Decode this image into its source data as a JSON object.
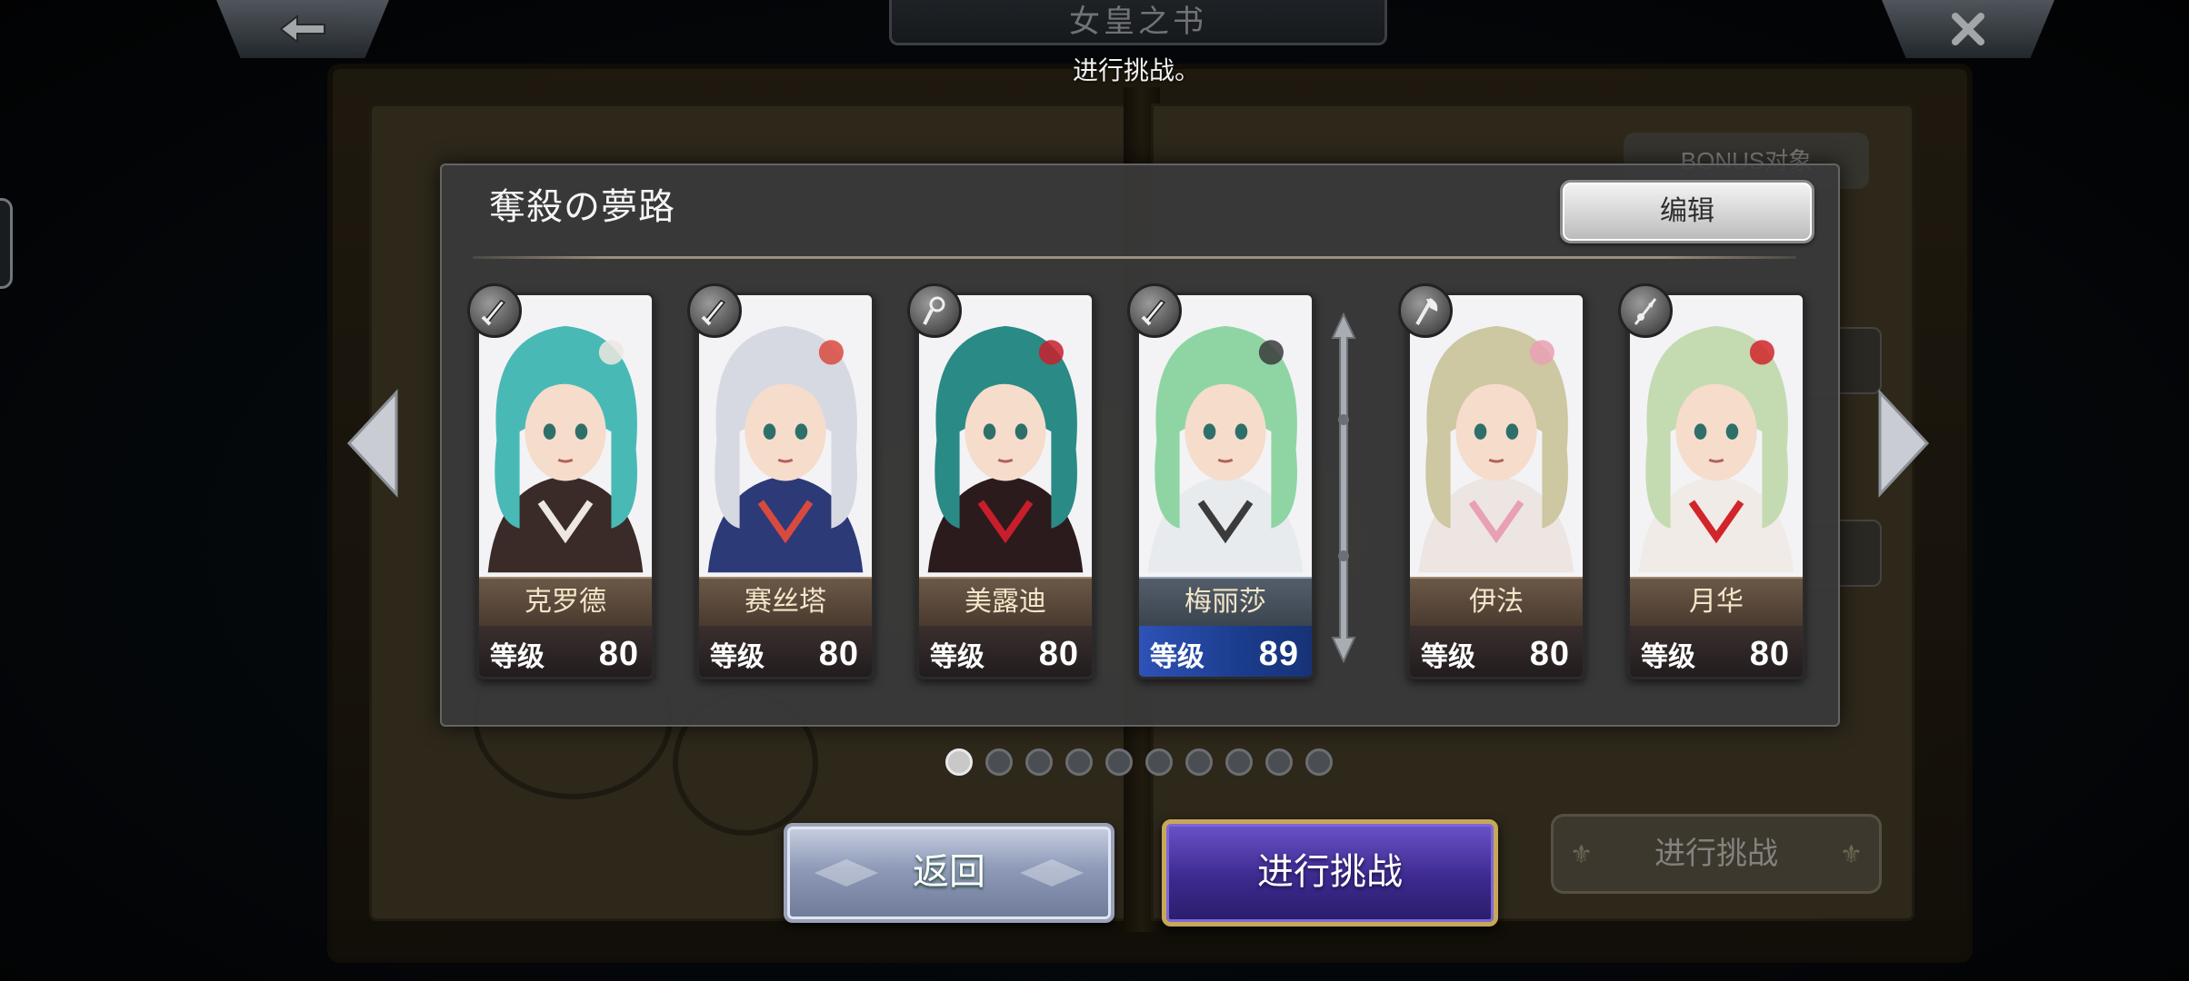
{
  "header": {
    "book_title": "女皇之书",
    "hint_text": "进行挑战。"
  },
  "background": {
    "bonus_label": "BONUS对象",
    "challenge_label": "进行挑战"
  },
  "party": {
    "title": "奪殺の夢路",
    "edit_label": "编辑",
    "level_label": "等级",
    "members": [
      {
        "name": "克罗德",
        "level": "80",
        "class_icon": "sword-icon",
        "hair": "#49b9b6",
        "outfit": "#3a2b28",
        "accent": "#ece8df"
      },
      {
        "name": "赛丝塔",
        "level": "80",
        "class_icon": "sword-icon",
        "hair": "#d7d9e2",
        "outfit": "#2c3a78",
        "accent": "#d94a3e"
      },
      {
        "name": "美露迪",
        "level": "80",
        "class_icon": "staff-icon",
        "hair": "#2a8a86",
        "outfit": "#2b1b1d",
        "accent": "#c81e2c"
      },
      {
        "name": "梅丽莎",
        "level": "89",
        "class_icon": "sword-icon",
        "hair": "#8fd5a3",
        "outfit": "#e7ebee",
        "accent": "#3b3b3b"
      },
      {
        "name": "伊法",
        "level": "80",
        "class_icon": "axe-icon",
        "hair": "#cdc7a2",
        "outfit": "#ece5e2",
        "accent": "#e9a0b4"
      },
      {
        "name": "月华",
        "level": "80",
        "class_icon": "spear-icon",
        "hair": "#c4dbb1",
        "outfit": "#f0ebe6",
        "accent": "#d1252b"
      }
    ],
    "highlight_index": 3
  },
  "pagination": {
    "total_pages": 10,
    "active_page": 1
  },
  "buttons": {
    "back_label": "返回",
    "challenge_label": "进行挑战"
  },
  "colors": {
    "panel_bg": "#3a3a3a",
    "challenge_button": "#3d2a8f",
    "challenge_border": "#c7a75a",
    "back_button": "#8e9ab8",
    "highlight_level_bar": "#2e52b6"
  }
}
